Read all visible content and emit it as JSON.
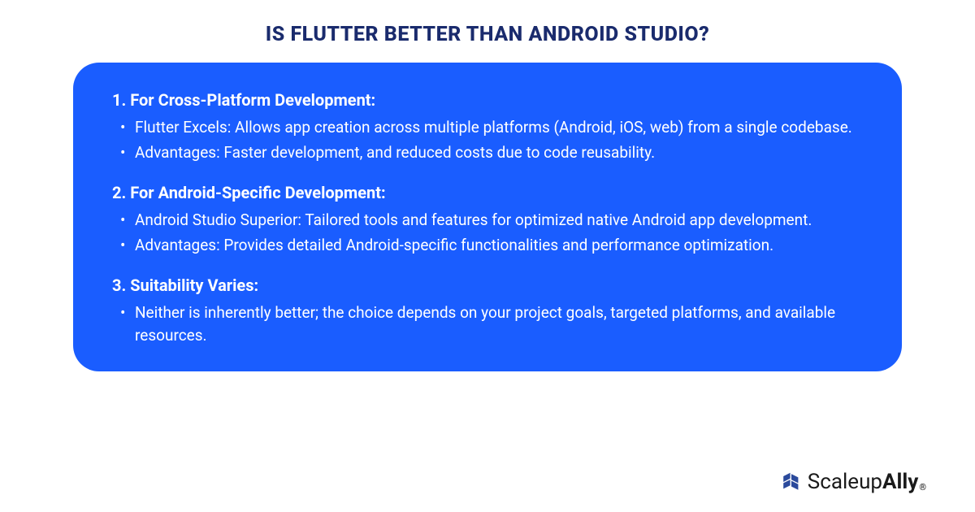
{
  "title": "IS FLUTTER BETTER THAN ANDROID STUDIO?",
  "sections": [
    {
      "heading": "1. For Cross-Platform Development:",
      "bullets": [
        "Flutter Excels: Allows app creation across multiple platforms (Android, iOS, web) from a single codebase.",
        "Advantages: Faster development, and reduced costs due to code reusability."
      ]
    },
    {
      "heading": "2. For Android-Specific Development:",
      "bullets": [
        "Android Studio Superior: Tailored tools and features for optimized native Android app development.",
        "Advantages: Provides detailed Android-specific functionalities and performance optimization."
      ]
    },
    {
      "heading": "3. Suitability Varies:",
      "bullets": [
        "Neither is inherently better; the choice depends on your project goals, targeted platforms, and available resources."
      ]
    }
  ],
  "brand": {
    "name_part1": "Scaleup",
    "name_part2": "Ally",
    "registered": "®"
  },
  "colors": {
    "title": "#1a2b6d",
    "card_bg": "#1a5dff",
    "card_text": "#ffffff",
    "brand_text": "#1a1a1a",
    "brand_icon": "#2b4a9c"
  }
}
